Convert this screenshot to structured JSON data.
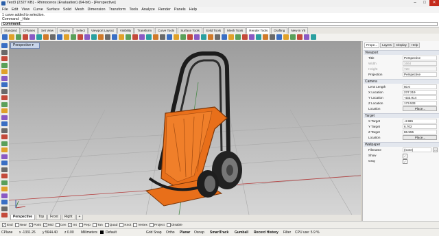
{
  "window": {
    "title": "Test3 (2327 KB) - Rhinoceros (Evaluation) (64-bit) - [Perspective]",
    "minimize": "–",
    "maximize": "□",
    "close": "✕"
  },
  "menu": [
    "File",
    "Edit",
    "View",
    "Curve",
    "Surface",
    "Solid",
    "Mesh",
    "Dimension",
    "Transform",
    "Tools",
    "Analyze",
    "Render",
    "Panels",
    "Help"
  ],
  "command_history": [
    "1 curve added to selection.",
    "Command: _Hide"
  ],
  "command_prompt": "Command:",
  "toolbar_tabs": [
    "Standard",
    "CPlanes",
    "Set View",
    "Display",
    "Select",
    "Viewport Layout",
    "Visibility",
    "Transform",
    "Curve Tools",
    "Surface Tools",
    "Solid Tools",
    "Mesh Tools",
    "Render Tools",
    "Drafting",
    "New in V5"
  ],
  "active_toolbar_tab": "Render Tools",
  "viewport": {
    "label": "Perspective",
    "label_arrow": "▾"
  },
  "viewport_tabs": [
    "Perspective",
    "Top",
    "Front",
    "Right"
  ],
  "viewport_add": "+",
  "osnap": [
    {
      "label": "End",
      "checked": true
    },
    {
      "label": "Near",
      "checked": false
    },
    {
      "label": "Point",
      "checked": true
    },
    {
      "label": "Mid",
      "checked": true
    },
    {
      "label": "Cen",
      "checked": false
    },
    {
      "label": "Int",
      "checked": true
    },
    {
      "label": "Perp",
      "checked": false
    },
    {
      "label": "Tan",
      "checked": false
    },
    {
      "label": "Quad",
      "checked": false
    },
    {
      "label": "Knot",
      "checked": false
    },
    {
      "label": "Vertex",
      "checked": false
    },
    {
      "label": "Project",
      "checked": false
    },
    {
      "label": "Disable",
      "checked": false
    }
  ],
  "status": {
    "cplane": "CPlane",
    "x": "x -1331.26",
    "y": "y 5644.40",
    "z": "z 0.00",
    "units": "Millimeters",
    "layer": "Default",
    "toggles": [
      "Grid Snap",
      "Ortho",
      "Planar",
      "Osnap",
      "SmartTrack",
      "Gumball",
      "Record History",
      "Filter"
    ],
    "cpu": "CPU use: 5.9 %"
  },
  "panel": {
    "tabs": [
      "Prope...",
      "Layers",
      "Display",
      "Help"
    ],
    "active_tab": "Prope...",
    "sections": {
      "viewport": {
        "header": "Viewport",
        "rows": [
          {
            "label": "Title",
            "value": "Perspective"
          },
          {
            "label": "Width",
            "value": "1664"
          },
          {
            "label": "Height",
            "value": "720"
          },
          {
            "label": "Projection",
            "value": "Perspective"
          }
        ]
      },
      "camera": {
        "header": "Camera",
        "rows": [
          {
            "label": "Lens Length",
            "value": "50.0"
          },
          {
            "label": "X Location",
            "value": "237.219"
          },
          {
            "label": "Y Location",
            "value": "-433.914"
          },
          {
            "label": "Z Location",
            "value": "173.533"
          },
          {
            "label": "Location",
            "value": "Place..."
          }
        ]
      },
      "target": {
        "header": "Target",
        "rows": [
          {
            "label": "X Target",
            "value": "-4.965"
          },
          {
            "label": "Y Target",
            "value": "6.702"
          },
          {
            "label": "Z Target",
            "value": "86.555"
          },
          {
            "label": "Location",
            "value": "Place..."
          }
        ]
      },
      "wallpaper": {
        "header": "Wallpaper",
        "rows": [
          {
            "label": "Filename",
            "value": "(none)"
          },
          {
            "label": "Show",
            "checked": true
          },
          {
            "label": "Gray",
            "checked": true
          }
        ],
        "browse": "..."
      }
    }
  },
  "colors": {
    "accent": "#e86f1a",
    "frame": "#1c1c1c",
    "panel_header": "#e3e7ee"
  }
}
